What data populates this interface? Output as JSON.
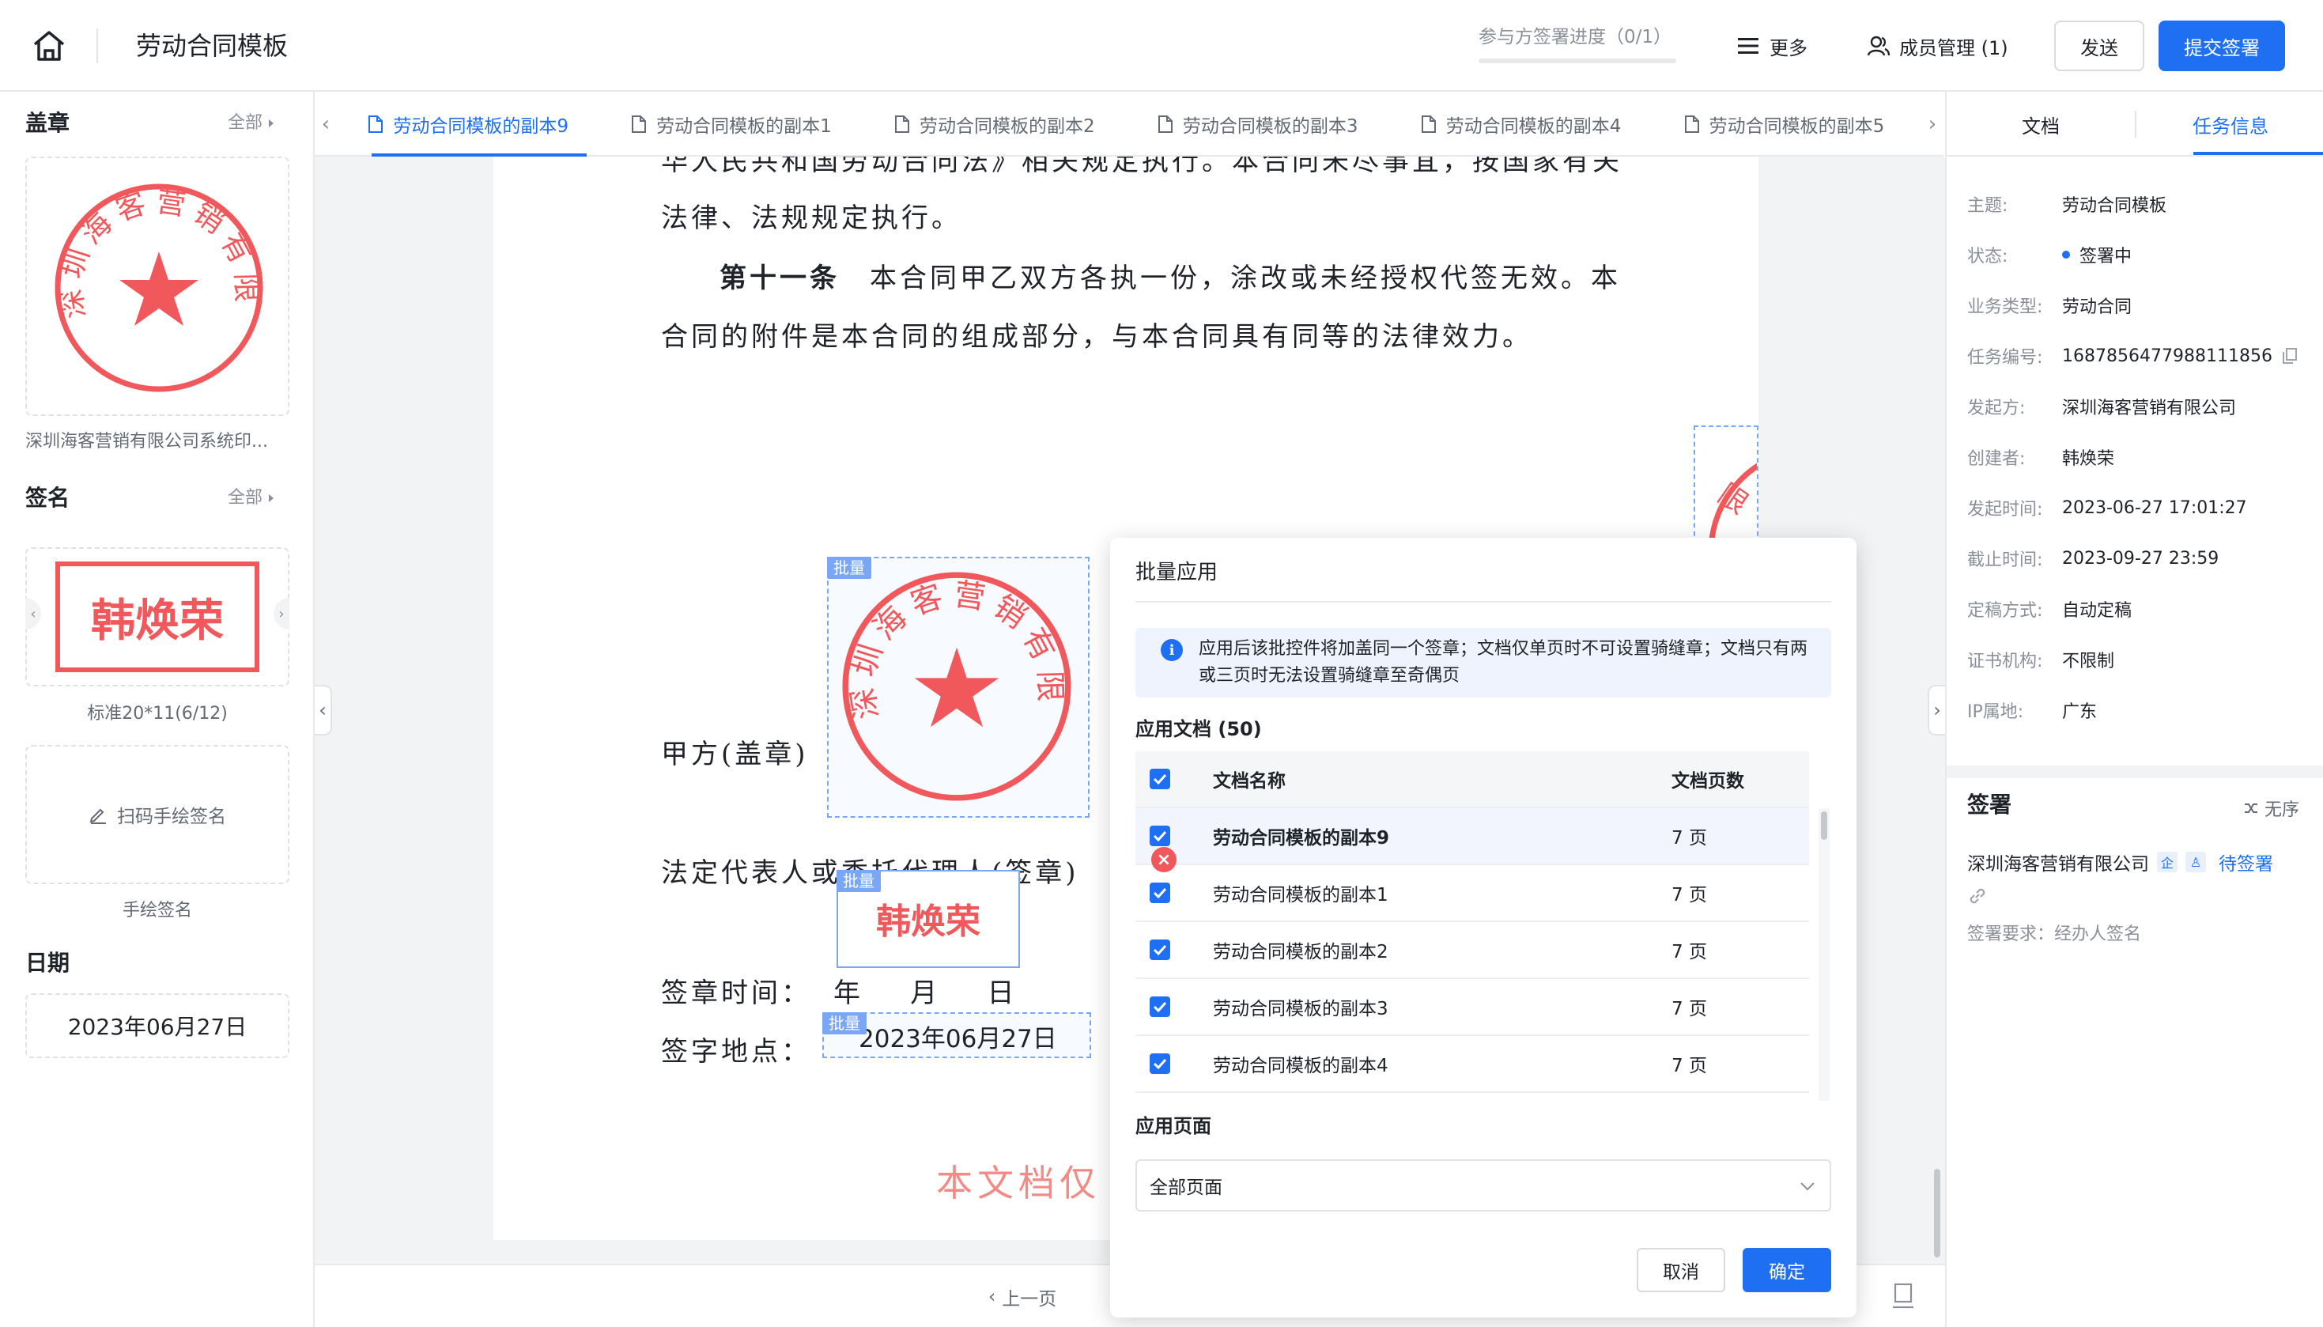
{
  "header": {
    "title": "劳动合同模板",
    "progress_label": "参与方签署进度（0/1）",
    "progress_ratio": 0,
    "more_label": "更多",
    "member_label": "成员管理 (1)",
    "send_label": "发送",
    "submit_label": "提交签署"
  },
  "colors": {
    "accent": "#1e6ff1",
    "seal_red": "#f0585b",
    "batch_tag": "#7aa7f5"
  },
  "left": {
    "seal_section": {
      "title": "盖章",
      "all_label": "全部",
      "seal_text": "深圳海客营销有限公司",
      "caption": "深圳海客营销有限公司系统印..."
    },
    "signature_section": {
      "title": "签名",
      "all_label": "全部",
      "signature_text": "韩焕荣",
      "caption": "标准20*11(6/12)",
      "handwrite_label": "扫码手绘签名",
      "handwrite_caption": "手绘签名"
    },
    "date_section": {
      "title": "日期",
      "value": "2023年06月27日"
    }
  },
  "tabs": [
    {
      "label": "劳动合同模板的副本9",
      "active": true
    },
    {
      "label": "劳动合同模板的副本1",
      "active": false
    },
    {
      "label": "劳动合同模板的副本2",
      "active": false
    },
    {
      "label": "劳动合同模板的副本3",
      "active": false
    },
    {
      "label": "劳动合同模板的副本4",
      "active": false
    },
    {
      "label": "劳动合同模板的副本5",
      "active": false
    }
  ],
  "document": {
    "line0": "华人民共和国劳动合同法》相关规定执行。本合同未尽事宜，按国家有关",
    "line1": "法律、法规规定执行。",
    "article_title": "第十一条",
    "line2": "本合同甲乙双方各执一份，涂改或未经授权代签无效。本",
    "line3": "合同的附件是本合同的组成部分，与本合同具有同等的法律效力。",
    "party_a": "甲方(盖章)",
    "legal_rep": "法定代表人或委托代理人(签章)",
    "sign_time": "签章时间：",
    "sign_time_fields": "年    月    日",
    "sign_place": "签字地点：",
    "watermark": "本文档仅",
    "batch_tag": "批量",
    "stamp_text": "深圳海客营销有限公司",
    "signature_text": "韩焕荣",
    "date_value": "2023年06月27日",
    "side_seal_chars": "限"
  },
  "bottom_bar": {
    "prev_label": "上一页"
  },
  "modal": {
    "title": "批量应用",
    "info": "应用后该批控件将加盖同一个签章；文档仅单页时不可设置骑缝章；文档只有两或三页时无法设置骑缝章至奇偶页",
    "docs_label": "应用文档 (50)",
    "table": {
      "headers": [
        "文档名称",
        "文档页数"
      ],
      "rows": [
        {
          "name": "劳动合同模板的副本9",
          "pages": "7 页",
          "bold": true
        },
        {
          "name": "劳动合同模板的副本1",
          "pages": "7 页",
          "bold": false
        },
        {
          "name": "劳动合同模板的副本2",
          "pages": "7 页",
          "bold": false
        },
        {
          "name": "劳动合同模板的副本3",
          "pages": "7 页",
          "bold": false
        },
        {
          "name": "劳动合同模板的副本4",
          "pages": "7 页",
          "bold": false
        }
      ]
    },
    "pages_label": "应用页面",
    "pages_value": "全部页面",
    "cancel_label": "取消",
    "ok_label": "确定"
  },
  "right": {
    "tabs": [
      {
        "label": "文档",
        "active": false
      },
      {
        "label": "任务信息",
        "active": true
      }
    ],
    "info": [
      {
        "label": "主题:",
        "value": "劳动合同模板"
      },
      {
        "label": "状态:",
        "value": "签署中"
      },
      {
        "label": "业务类型:",
        "value": "劳动合同"
      },
      {
        "label": "任务编号:",
        "value": "1687856477988111856"
      },
      {
        "label": "发起方:",
        "value": "深圳海客营销有限公司"
      },
      {
        "label": "创建者:",
        "value": "韩焕荣"
      },
      {
        "label": "发起时间:",
        "value": "2023-06-27 17:01:27"
      },
      {
        "label": "截止时间:",
        "value": "2023-09-27 23:59"
      },
      {
        "label": "定稿方式:",
        "value": "自动定稿"
      },
      {
        "label": "证书机构:",
        "value": "不限制"
      },
      {
        "label": "IP属地:",
        "value": "广东"
      }
    ],
    "sign_section": {
      "title": "签署",
      "order_label": "无序",
      "signer": "深圳海客营销有限公司",
      "status": "待签署",
      "requirement": "签署要求：经办人签名"
    }
  }
}
